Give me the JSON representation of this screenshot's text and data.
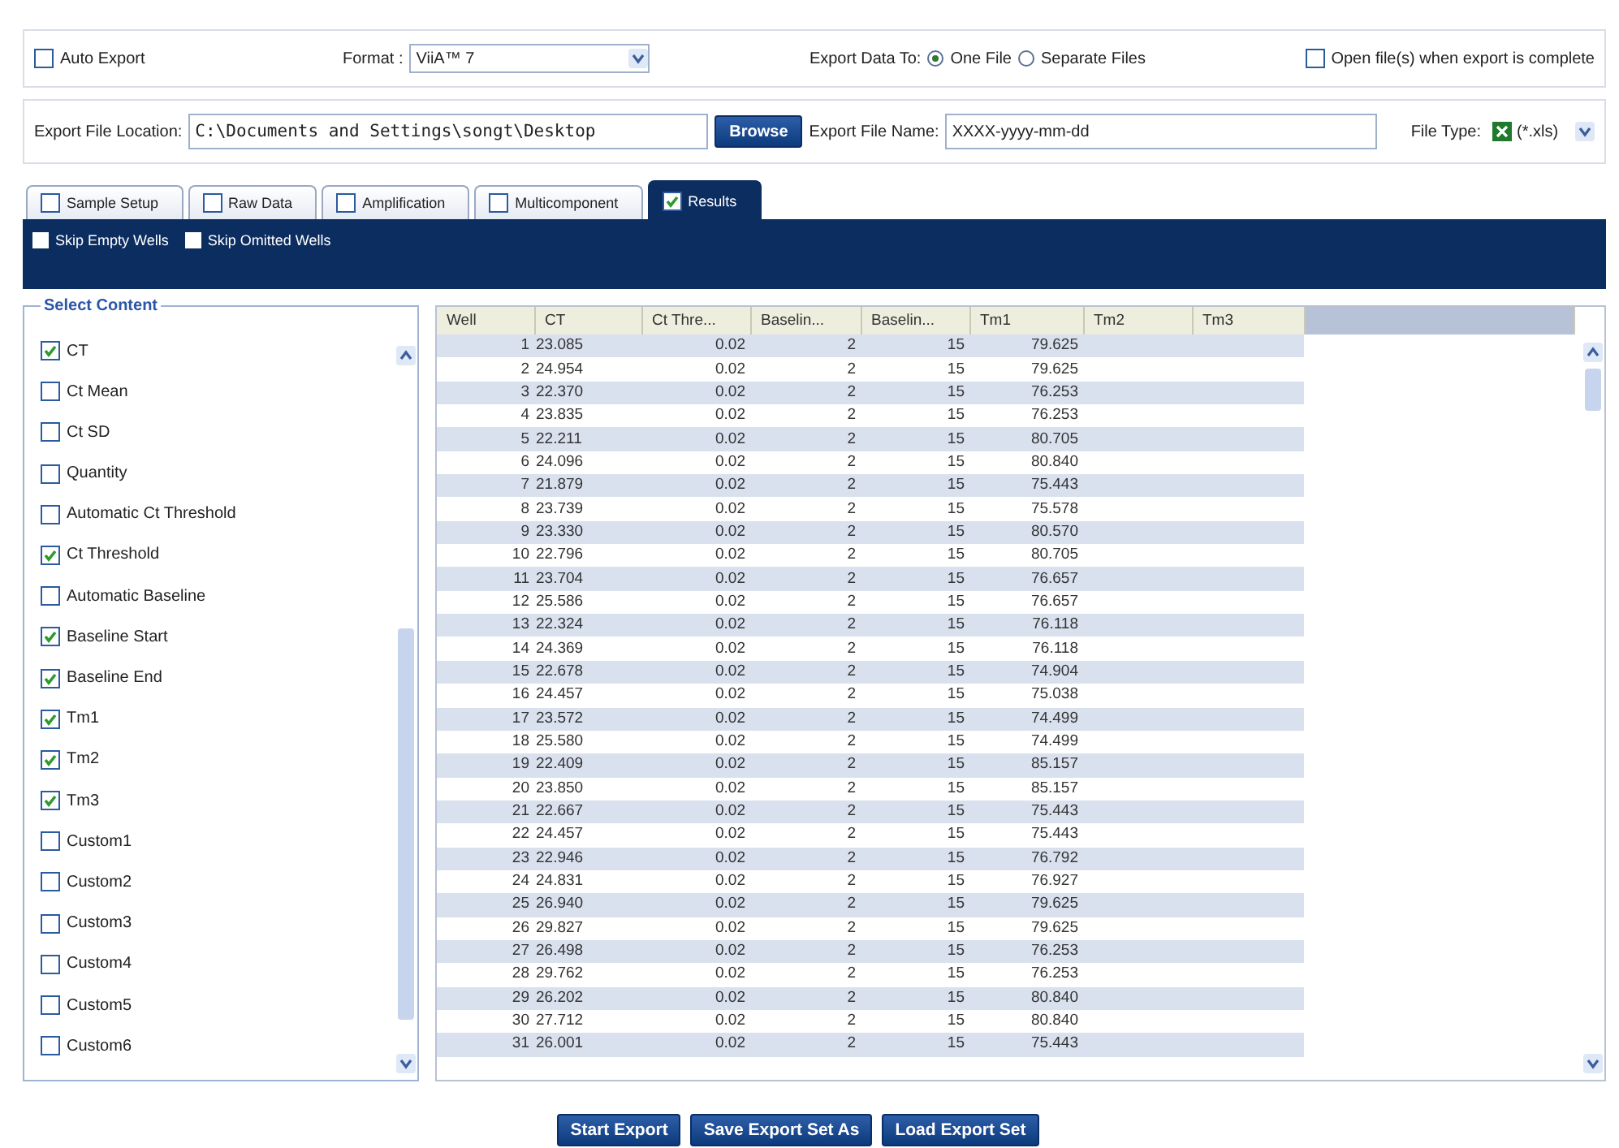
{
  "options": {
    "auto_export": {
      "label": "Auto Export",
      "checked": false
    },
    "format": {
      "label": "Format :",
      "value": "ViiA™ 7"
    },
    "export_to": {
      "label": "Export Data To:",
      "options": [
        {
          "label": "One File",
          "selected": true
        },
        {
          "label": "Separate Files",
          "selected": false
        }
      ]
    },
    "open_files": {
      "label": "Open file(s) when export is complete",
      "checked": false
    }
  },
  "location": {
    "label": "Export File Location:",
    "value": "C:\\Documents and Settings\\songt\\Desktop",
    "browse": "Browse",
    "file_name_label": "Export File Name:",
    "file_name": "XXXX-yyyy-mm-dd",
    "file_type_label": "File Type:",
    "file_type": "(*.xls)"
  },
  "tabs": [
    {
      "label": "Sample Setup",
      "checked": false,
      "selected": false
    },
    {
      "label": "Raw Data",
      "checked": false,
      "selected": false
    },
    {
      "label": "Amplification",
      "checked": false,
      "selected": false
    },
    {
      "label": "Multicomponent",
      "checked": false,
      "selected": false
    },
    {
      "label": "Results",
      "checked": true,
      "selected": true
    }
  ],
  "filters": [
    {
      "label": "Skip Empty Wells",
      "checked": false
    },
    {
      "label": "Skip Omitted Wells",
      "checked": false
    }
  ],
  "content": {
    "title": "Select Content",
    "items": [
      {
        "label": "CT",
        "checked": true
      },
      {
        "label": "Ct Mean",
        "checked": false
      },
      {
        "label": "Ct SD",
        "checked": false
      },
      {
        "label": "Quantity",
        "checked": false
      },
      {
        "label": "Automatic Ct Threshold",
        "checked": false
      },
      {
        "label": "Ct Threshold",
        "checked": true
      },
      {
        "label": "Automatic Baseline",
        "checked": false
      },
      {
        "label": "Baseline Start",
        "checked": true
      },
      {
        "label": "Baseline End",
        "checked": true
      },
      {
        "label": "Tm1",
        "checked": true
      },
      {
        "label": "Tm2",
        "checked": true
      },
      {
        "label": "Tm3",
        "checked": true
      },
      {
        "label": "Custom1",
        "checked": false
      },
      {
        "label": "Custom2",
        "checked": false
      },
      {
        "label": "Custom3",
        "checked": false
      },
      {
        "label": "Custom4",
        "checked": false
      },
      {
        "label": "Custom5",
        "checked": false
      },
      {
        "label": "Custom6",
        "checked": false
      }
    ]
  },
  "table": {
    "columns": [
      "Well",
      "CT",
      "Ct Thre...",
      "Baselin...",
      "Baselin...",
      "Tm1",
      "Tm2",
      "Tm3"
    ],
    "rows": [
      [
        "1",
        "23.085",
        "0.02",
        "2",
        "15",
        "79.625"
      ],
      [
        "2",
        "24.954",
        "0.02",
        "2",
        "15",
        "79.625"
      ],
      [
        "3",
        "22.370",
        "0.02",
        "2",
        "15",
        "76.253"
      ],
      [
        "4",
        "23.835",
        "0.02",
        "2",
        "15",
        "76.253"
      ],
      [
        "5",
        "22.211",
        "0.02",
        "2",
        "15",
        "80.705"
      ],
      [
        "6",
        "24.096",
        "0.02",
        "2",
        "15",
        "80.840"
      ],
      [
        "7",
        "21.879",
        "0.02",
        "2",
        "15",
        "75.443"
      ],
      [
        "8",
        "23.739",
        "0.02",
        "2",
        "15",
        "75.578"
      ],
      [
        "9",
        "23.330",
        "0.02",
        "2",
        "15",
        "80.570"
      ],
      [
        "10",
        "22.796",
        "0.02",
        "2",
        "15",
        "80.705"
      ],
      [
        "11",
        "23.704",
        "0.02",
        "2",
        "15",
        "76.657"
      ],
      [
        "12",
        "25.586",
        "0.02",
        "2",
        "15",
        "76.657"
      ],
      [
        "13",
        "22.324",
        "0.02",
        "2",
        "15",
        "76.118"
      ],
      [
        "14",
        "24.369",
        "0.02",
        "2",
        "15",
        "76.118"
      ],
      [
        "15",
        "22.678",
        "0.02",
        "2",
        "15",
        "74.904"
      ],
      [
        "16",
        "24.457",
        "0.02",
        "2",
        "15",
        "75.038"
      ],
      [
        "17",
        "23.572",
        "0.02",
        "2",
        "15",
        "74.499"
      ],
      [
        "18",
        "25.580",
        "0.02",
        "2",
        "15",
        "74.499"
      ],
      [
        "19",
        "22.409",
        "0.02",
        "2",
        "15",
        "85.157"
      ],
      [
        "20",
        "23.850",
        "0.02",
        "2",
        "15",
        "85.157"
      ],
      [
        "21",
        "22.667",
        "0.02",
        "2",
        "15",
        "75.443"
      ],
      [
        "22",
        "24.457",
        "0.02",
        "2",
        "15",
        "75.443"
      ],
      [
        "23",
        "22.946",
        "0.02",
        "2",
        "15",
        "76.792"
      ],
      [
        "24",
        "24.831",
        "0.02",
        "2",
        "15",
        "76.927"
      ],
      [
        "25",
        "26.940",
        "0.02",
        "2",
        "15",
        "79.625"
      ],
      [
        "26",
        "29.827",
        "0.02",
        "2",
        "15",
        "79.625"
      ],
      [
        "27",
        "26.498",
        "0.02",
        "2",
        "15",
        "76.253"
      ],
      [
        "28",
        "29.762",
        "0.02",
        "2",
        "15",
        "76.253"
      ],
      [
        "29",
        "26.202",
        "0.02",
        "2",
        "15",
        "80.840"
      ],
      [
        "30",
        "27.712",
        "0.02",
        "2",
        "15",
        "80.840"
      ],
      [
        "31",
        "26.001",
        "0.02",
        "2",
        "15",
        "75.443"
      ]
    ]
  },
  "buttons": [
    "Start Export",
    "Save Export Set As",
    "Load Export Set"
  ]
}
